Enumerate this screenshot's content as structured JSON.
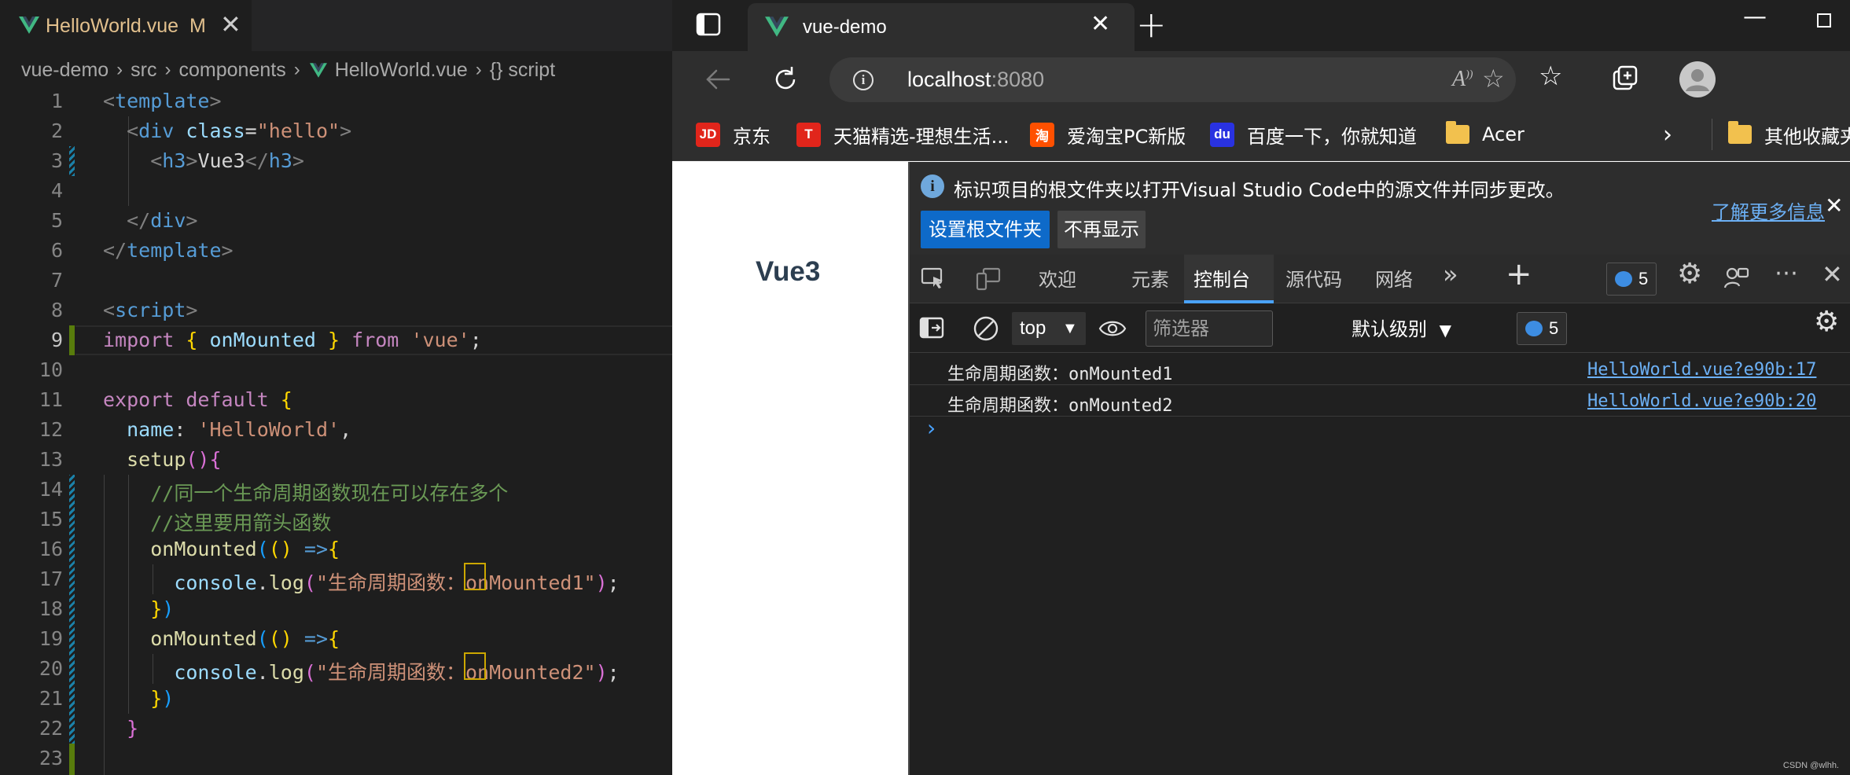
{
  "editor": {
    "tab": {
      "filename": "HelloWorld.vue",
      "status": "M",
      "close": "✕"
    },
    "breadcrumb": [
      "vue-demo",
      "src",
      "components",
      "HelloWorld.vue",
      "{} script"
    ],
    "line_numbers": [
      "1",
      "2",
      "3",
      "4",
      "5",
      "6",
      "7",
      "8",
      "9",
      "10",
      "11",
      "12",
      "13",
      "14",
      "15",
      "16",
      "17",
      "18",
      "19",
      "20",
      "21",
      "22",
      "23"
    ],
    "current_line": "9"
  },
  "browser": {
    "tab_title": "vue-demo",
    "address": {
      "host": "localhost",
      "port": ":8080"
    },
    "bookmarks": [
      {
        "label": "京东",
        "icon": "JD"
      },
      {
        "label": "天猫精选-理想生活...",
        "icon": "T"
      },
      {
        "label": "爱淘宝PC新版",
        "icon": "淘"
      },
      {
        "label": "百度一下，你就知道",
        "icon": "du"
      },
      {
        "label": "Acer",
        "icon": "folder-icon"
      },
      {
        "label": "其他收藏夹",
        "icon": "folder-icon"
      }
    ],
    "page_heading": "Vue3"
  },
  "devtools": {
    "infobar": {
      "message": "标识项目的根文件夹以打开Visual Studio Code中的源文件并同步更改。",
      "set_root_button": "设置根文件夹",
      "dont_show_button": "不再显示",
      "learn_more": "了解更多信息"
    },
    "tabs": [
      "欢迎",
      "元素",
      "控制台",
      "源代码",
      "网络"
    ],
    "active_tab": "控制台",
    "issues_count": "5",
    "console": {
      "context": "top",
      "filter_placeholder": "筛选器",
      "level": "默认级别",
      "message_count": "5",
      "logs": [
        {
          "text": "生命周期函数：onMounted1",
          "source": "HelloWorld.vue?e90b:17"
        },
        {
          "text": "生命周期函数：onMounted2",
          "source": "HelloWorld.vue?e90b:20"
        }
      ],
      "prompt": "›"
    }
  },
  "watermark": "CSDN @wlhh."
}
